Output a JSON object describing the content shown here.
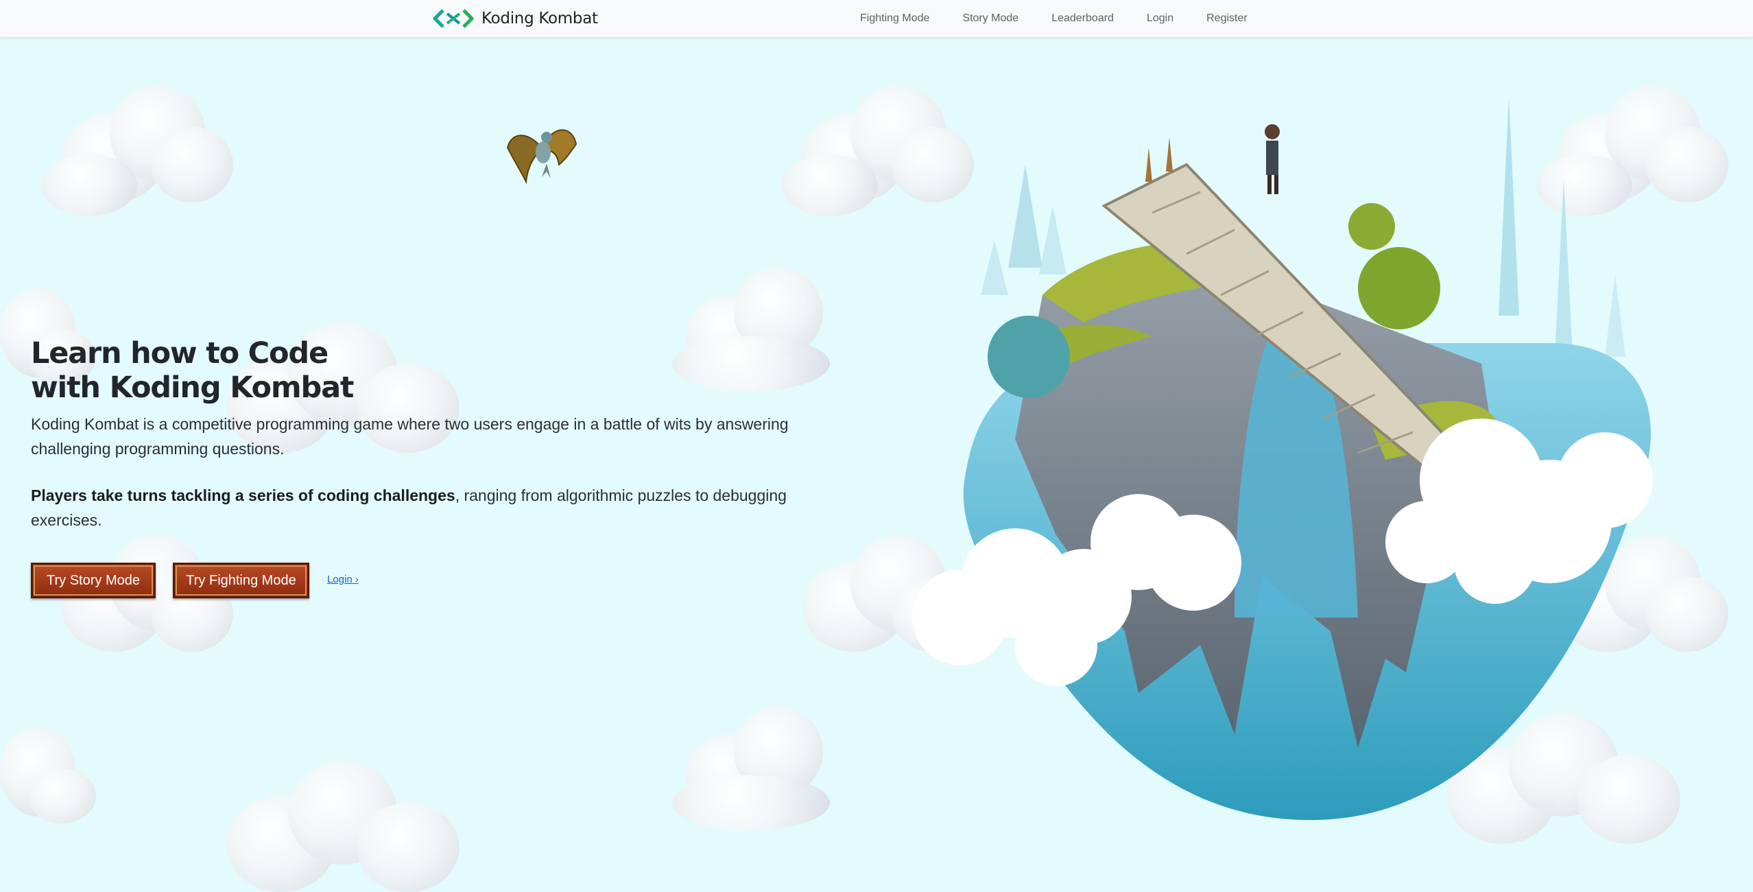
{
  "nav": {
    "brand": "Koding Kombat",
    "links": [
      {
        "label": "Fighting Mode"
      },
      {
        "label": "Story Mode"
      },
      {
        "label": "Leaderboard"
      },
      {
        "label": "Login"
      },
      {
        "label": "Register"
      }
    ]
  },
  "hero": {
    "title_line1": "Learn how to Code",
    "title_line2": "with Koding Kombat",
    "description": "Koding Kombat is a competitive programming game where two users engage in a battle of wits by answering challenging programming questions.",
    "detail_bold": "Players take turns tackling a series of coding challenges",
    "detail_rest": ", ranging from algorithmic puzzles to debugging exercises.",
    "story_button": "Try Story Mode",
    "fight_button": "Try Fighting Mode",
    "login_link": "Login ›"
  },
  "colors": {
    "background": "#e3fbfd",
    "navbar": "#f8f9fa",
    "button": "#a33b1b",
    "link": "#1b5fd0",
    "logo_accent": "#16a79a"
  },
  "icons": {
    "logo": "code-brackets-logo-icon",
    "dragon": "dragon-illustration",
    "island": "floating-island-illustration"
  }
}
